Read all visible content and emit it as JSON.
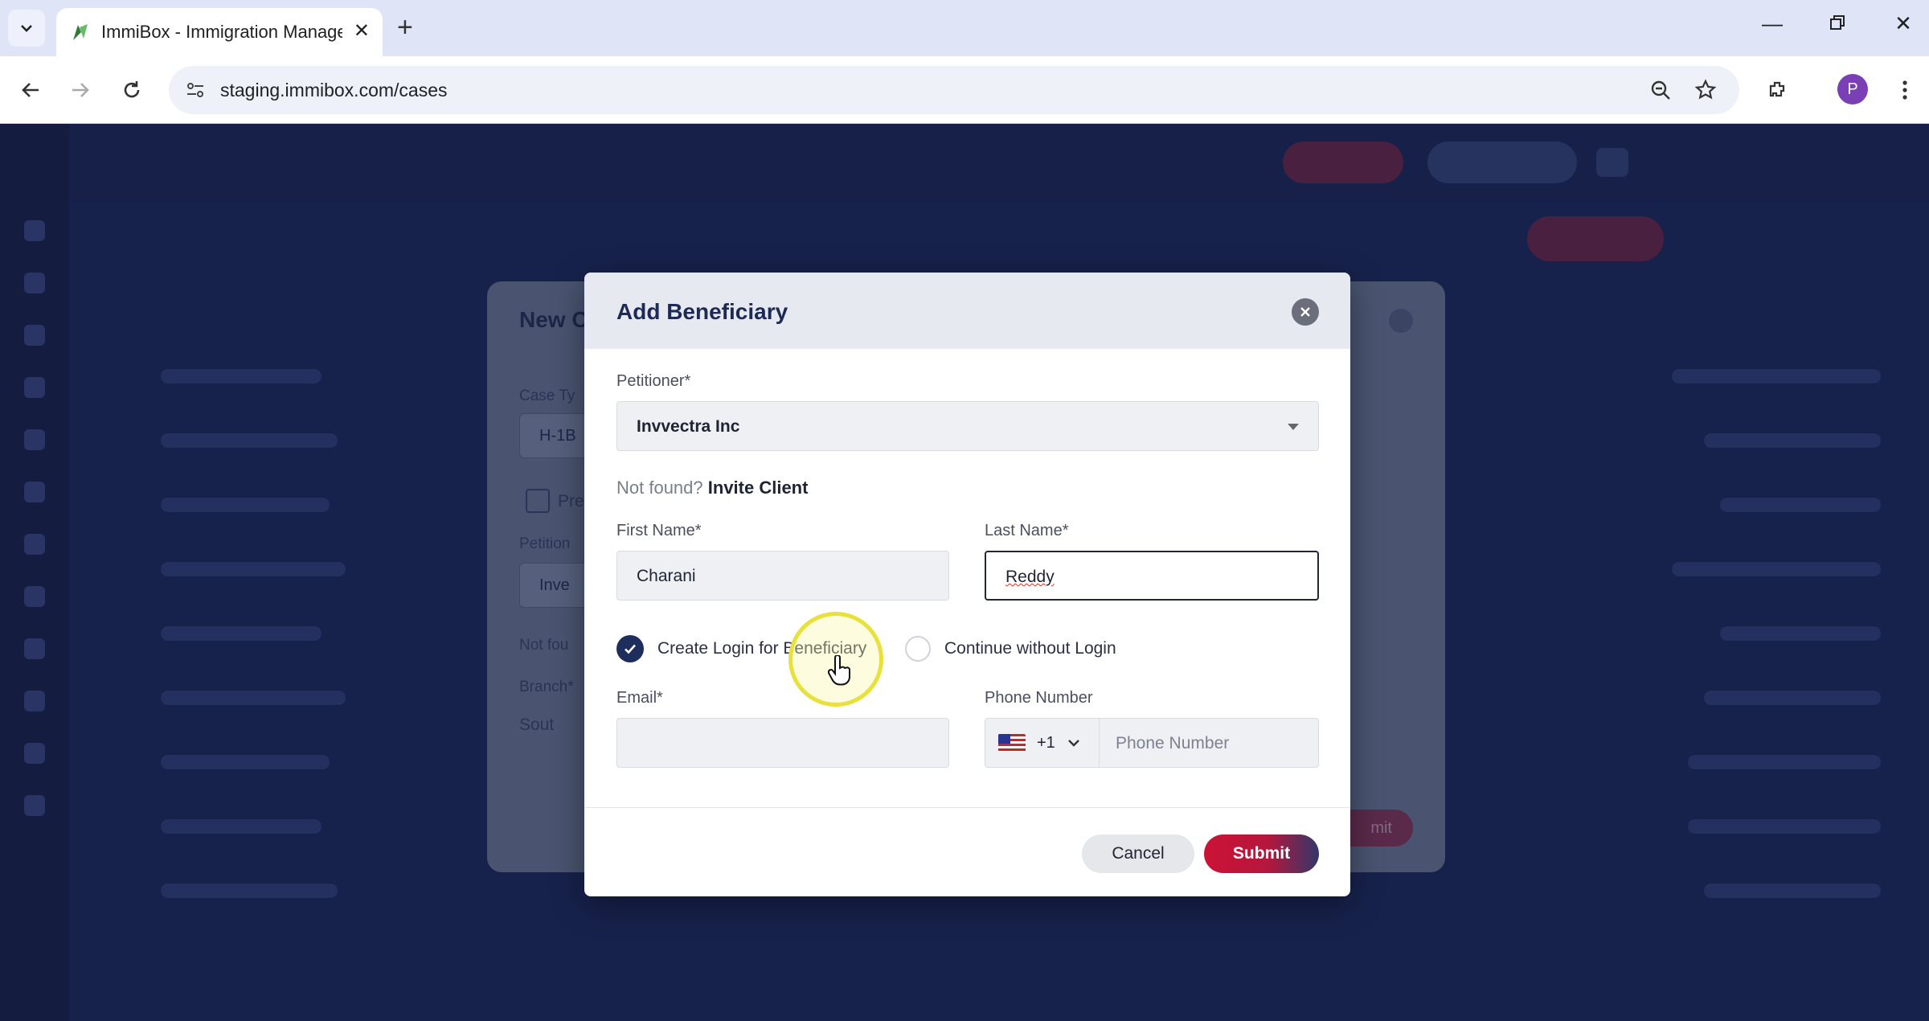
{
  "browser": {
    "tab_title": "ImmiBox - Immigration Manage",
    "url": "staging.immibox.com/cases",
    "profile_initial": "P"
  },
  "underlying_dialog": {
    "title": "New C",
    "case_type_label": "Case Ty",
    "case_type_value": "H-1B",
    "premium_label": "Pre",
    "petitioner_label": "Petition",
    "petitioner_value": "Inve",
    "not_found_text": "Not fou",
    "branch_label": "Branch*",
    "branch_value": "Sout",
    "submit_label": "mit"
  },
  "modal": {
    "title": "Add Beneficiary",
    "petitioner_label": "Petitioner*",
    "petitioner_value": "Invvectra Inc",
    "not_found_text": "Not found?",
    "invite_client": "Invite Client",
    "first_name_label": "First Name*",
    "first_name_value": "Charani",
    "last_name_label": "Last Name*",
    "last_name_value": "Reddy",
    "option_create_login": "Create Login for Beneficiary",
    "option_without_login": "Continue without Login",
    "selected_option": "Create Login for Beneficiary",
    "email_label": "Email*",
    "email_value": "",
    "phone_label": "Phone Number",
    "country_code": "+1",
    "phone_placeholder": "Phone Number",
    "cancel": "Cancel",
    "submit": "Submit"
  },
  "colors": {
    "primary_navy": "#1d2d5c",
    "submit_red": "#cc1236",
    "overlay": "#17224c"
  }
}
